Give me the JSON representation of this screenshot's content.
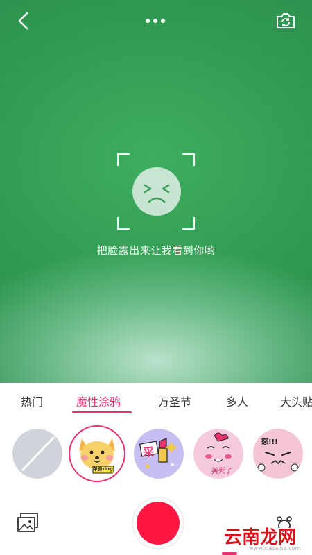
{
  "camera": {
    "hint_text": "把脸露出来让我看到你哟"
  },
  "tabs": [
    {
      "label": "热门",
      "active": false
    },
    {
      "label": "魔性涂鸦",
      "active": true
    },
    {
      "label": "万圣节",
      "active": false
    },
    {
      "label": "多人",
      "active": false
    },
    {
      "label": "大头贴",
      "active": false
    }
  ],
  "stickers": [
    {
      "name": "none",
      "selected": false
    },
    {
      "name": "dog-doodle",
      "text": "单身dog",
      "selected": true
    },
    {
      "name": "lipstick-doodle",
      "text": "采",
      "selected": false
    },
    {
      "name": "girl-doodle",
      "text": "美死了",
      "selected": false
    },
    {
      "name": "angry-doodle",
      "text": "怒!!!",
      "selected": false
    }
  ],
  "watermark": {
    "text": "云南龙网",
    "site": "www.xiazaiba.com"
  },
  "colors": {
    "accent": "#e8336d",
    "shutter": "#ff1744"
  }
}
